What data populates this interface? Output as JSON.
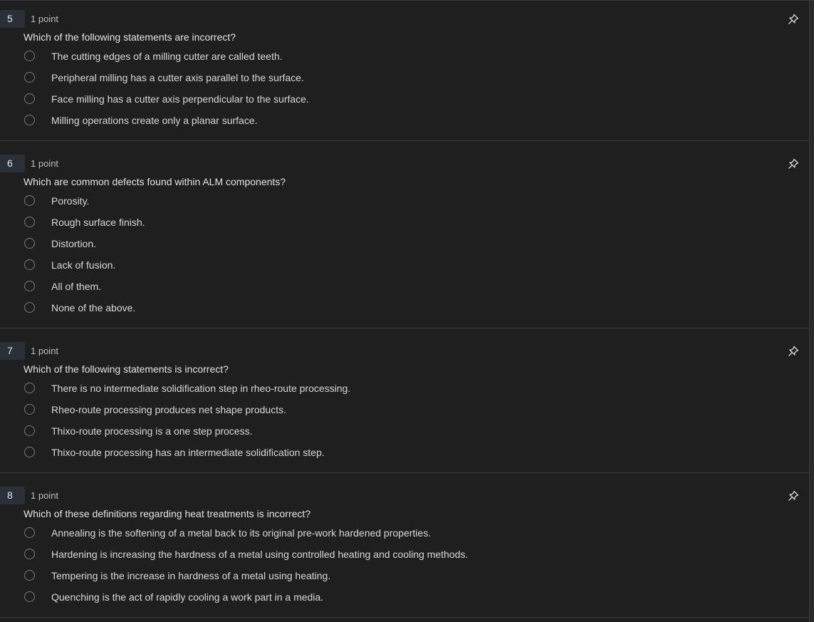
{
  "questions": [
    {
      "number": "5",
      "points": "1 point",
      "text": "Which of the following statements are incorrect?",
      "options": [
        "The cutting edges of a milling cutter are called teeth.",
        "Peripheral milling has a cutter axis parallel to the surface.",
        "Face milling has a cutter axis perpendicular to the surface.",
        "Milling operations create only a planar surface."
      ]
    },
    {
      "number": "6",
      "points": "1 point",
      "text": "Which are common defects found within ALM components?",
      "options": [
        "Porosity.",
        "Rough surface finish.",
        "Distortion.",
        "Lack of fusion.",
        "All of them.",
        "None of the above."
      ]
    },
    {
      "number": "7",
      "points": "1 point",
      "text": "Which of the following statements is incorrect?",
      "options": [
        "There is no intermediate solidification step in rheo-route processing.",
        "Rheo-route processing produces net shape products.",
        "Thixo-route processing is a one step process.",
        "Thixo-route processing has an intermediate solidification step."
      ]
    },
    {
      "number": "8",
      "points": "1 point",
      "text": "Which of these definitions regarding heat treatments is incorrect?",
      "options": [
        "Annealing is the softening of a metal back to its original pre-work hardened properties.",
        "Hardening is increasing the hardness of a metal using controlled heating and cooling methods.",
        "Tempering is the increase in hardness of a metal using heating.",
        "Quenching is the act of rapidly cooling a work part in a media."
      ]
    }
  ],
  "icons": {
    "pin": "pin-icon",
    "radio": "radio-unchecked"
  },
  "colors": {
    "background": "#1f1f1f",
    "number_badge": "#2b3038",
    "text": "#e3e3e3",
    "divider": "#3d3d3d"
  }
}
